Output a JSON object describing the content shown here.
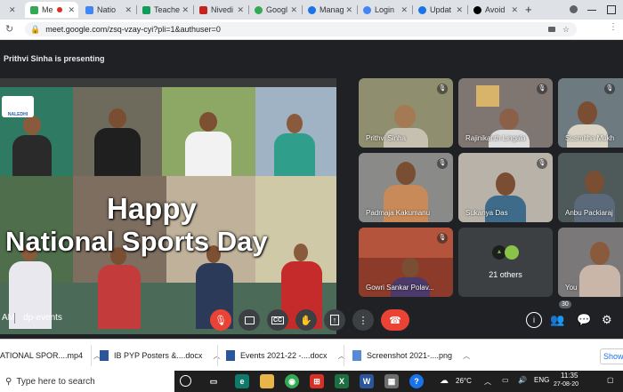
{
  "browser": {
    "tabs": [
      {
        "label": "Me",
        "color": "#34a853"
      },
      {
        "label": "Natio",
        "color": "#4285f4"
      },
      {
        "label": "Teache",
        "color": "#0f9d58"
      },
      {
        "label": "Nivedi",
        "color": "#c5221f"
      },
      {
        "label": "Googl",
        "color": "#34a853"
      },
      {
        "label": "Manag",
        "color": "#1a73e8"
      },
      {
        "label": "Login",
        "color": "#4285f4"
      },
      {
        "label": "Updat",
        "color": "#1a73e8"
      },
      {
        "label": "Avoid",
        "color": "#000000"
      }
    ],
    "new_tab": "+",
    "url": "meet.google.com/zsq-vzay-cyi?pli=1&authuser=0"
  },
  "meet": {
    "presenting": "Prithvi Sinha is presenting",
    "slide": {
      "line1": "Happy",
      "line2": "National Sports Day",
      "logo": "NALEDHI"
    },
    "participants": [
      {
        "name": "Prithvi Sinha",
        "bg": "#8f8e6e"
      },
      {
        "name": "Rajinikanth Lingala",
        "bg": "#7f7672"
      },
      {
        "name": "Susmitha Mukh",
        "bg": "#6d7a80"
      },
      {
        "name": "Padmaja Kakumanu",
        "bg": "#8a8a88"
      },
      {
        "name": "Sukanya Das",
        "bg": "#b8b2a8"
      },
      {
        "name": "Anbu Packiaraj",
        "bg": "#4e5a5a"
      },
      {
        "name": "Gowri Sankar Polav...",
        "bg": "#8c3a2a"
      },
      {
        "name": "21 others",
        "bg": "#3c4043"
      },
      {
        "name": "You",
        "bg": "#7a7878"
      }
    ],
    "meeting_time": "AM",
    "meeting_name": "dp-events",
    "people_count": "30"
  },
  "downloads": [
    {
      "name": "ATIONAL SPOR....mp4"
    },
    {
      "name": "IB PYP Posters &....docx"
    },
    {
      "name": "Events 2021-22 -....docx"
    },
    {
      "name": "Screenshot 2021-....png"
    }
  ],
  "downloads_show": "Show",
  "taskbar": {
    "search_placeholder": "Type here to search",
    "temperature": "26°C",
    "language": "ENG",
    "time": "11:35",
    "date": "27-08-20"
  }
}
